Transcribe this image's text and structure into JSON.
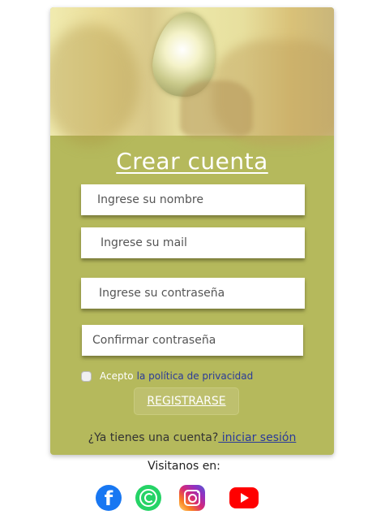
{
  "form": {
    "title": "Crear cuenta",
    "name_placeholder": "Ingrese su nombre",
    "mail_placeholder": "Ingrese su mail",
    "password_placeholder": "Ingrese su contraseña",
    "confirm_placeholder": "Confirmar contraseña",
    "terms_prefix": "Acepto",
    "terms_link": "la política de privacidad",
    "register_label": "REGISTRARSE",
    "have_account": "¿Ya tienes una cuenta?",
    "login_link": " iniciar sesión"
  },
  "footer": {
    "visit_label": "Visitanos en:",
    "socials": [
      "facebook-icon",
      "whatsapp-icon",
      "instagram-icon",
      "youtube-icon"
    ],
    "facebook_glyph": "f"
  },
  "colors": {
    "card": "#b5b95c",
    "link": "#2a3a9a",
    "facebook": "#1877f2",
    "whatsapp": "#25d366",
    "youtube": "#ff0000"
  }
}
